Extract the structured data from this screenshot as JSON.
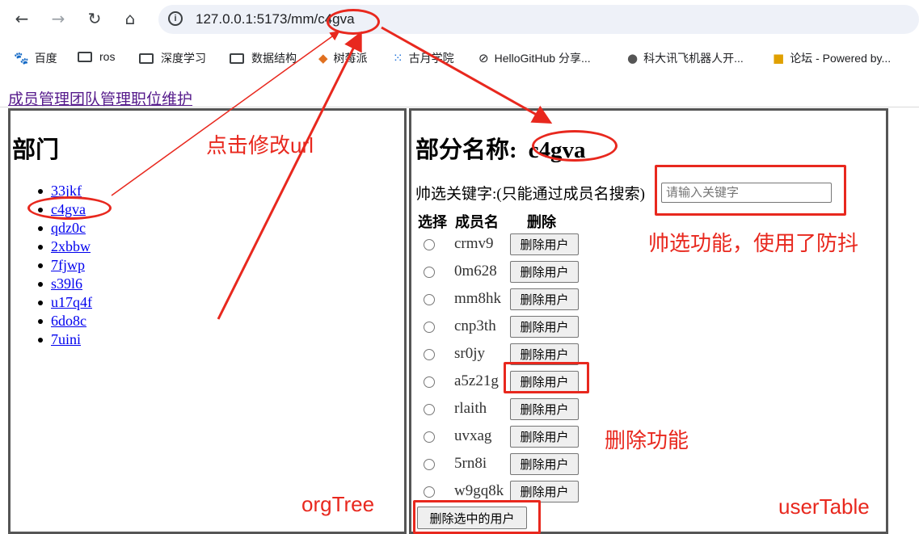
{
  "browser": {
    "url": "127.0.0.1:5173/mm/c4gva",
    "bookmarks": [
      {
        "label": "百度",
        "icon": "paw-icon"
      },
      {
        "label": "ros",
        "icon": "folder-icon"
      },
      {
        "label": "深度学习",
        "icon": "folder-icon"
      },
      {
        "label": "数据结构",
        "icon": "folder-icon"
      },
      {
        "label": "树莓派",
        "icon": "raspberry-icon"
      },
      {
        "label": "古月学院",
        "icon": "grid-icon"
      },
      {
        "label": "HelloGitHub 分享...",
        "icon": "github-icon"
      },
      {
        "label": "科大讯飞机器人开...",
        "icon": "globe-icon"
      },
      {
        "label": "论坛 - Powered by...",
        "icon": "forum-icon"
      }
    ]
  },
  "topnav": {
    "items": [
      "成员管理",
      "团队管理",
      "职位维护"
    ]
  },
  "left": {
    "heading": "部门",
    "departments": [
      "33jkf",
      "c4gva",
      "qdz0c",
      "2xbbw",
      "7fjwp",
      "s39l6",
      "u17q4f",
      "6do8c",
      "7uini"
    ]
  },
  "right": {
    "heading_prefix": "部分名称:",
    "heading_value": "c4gva",
    "filter_label": "帅选关键字:(只能通过成员名搜索)",
    "filter_placeholder": "请输入关键字",
    "columns": [
      "选择",
      "成员名",
      "删除"
    ],
    "users": [
      "crmv9",
      "0m628",
      "mm8hk",
      "cnp3th",
      "sr0jy",
      "a5z21g",
      "rlaith",
      "uvxag",
      "5rn8i",
      "w9gq8k"
    ],
    "delete_label": "删除用户",
    "delete_selected_label": "删除选中的用户"
  },
  "annotations": {
    "click_url": "点击修改url",
    "filter_note": "帅选功能，使用了防抖",
    "delete_note": "删除功能",
    "org_tree": "orgTree",
    "user_table": "userTable"
  },
  "colors": {
    "annotation_red": "#e8281e",
    "link_blue": "#0000ee",
    "visited_purple": "#551a8b"
  }
}
